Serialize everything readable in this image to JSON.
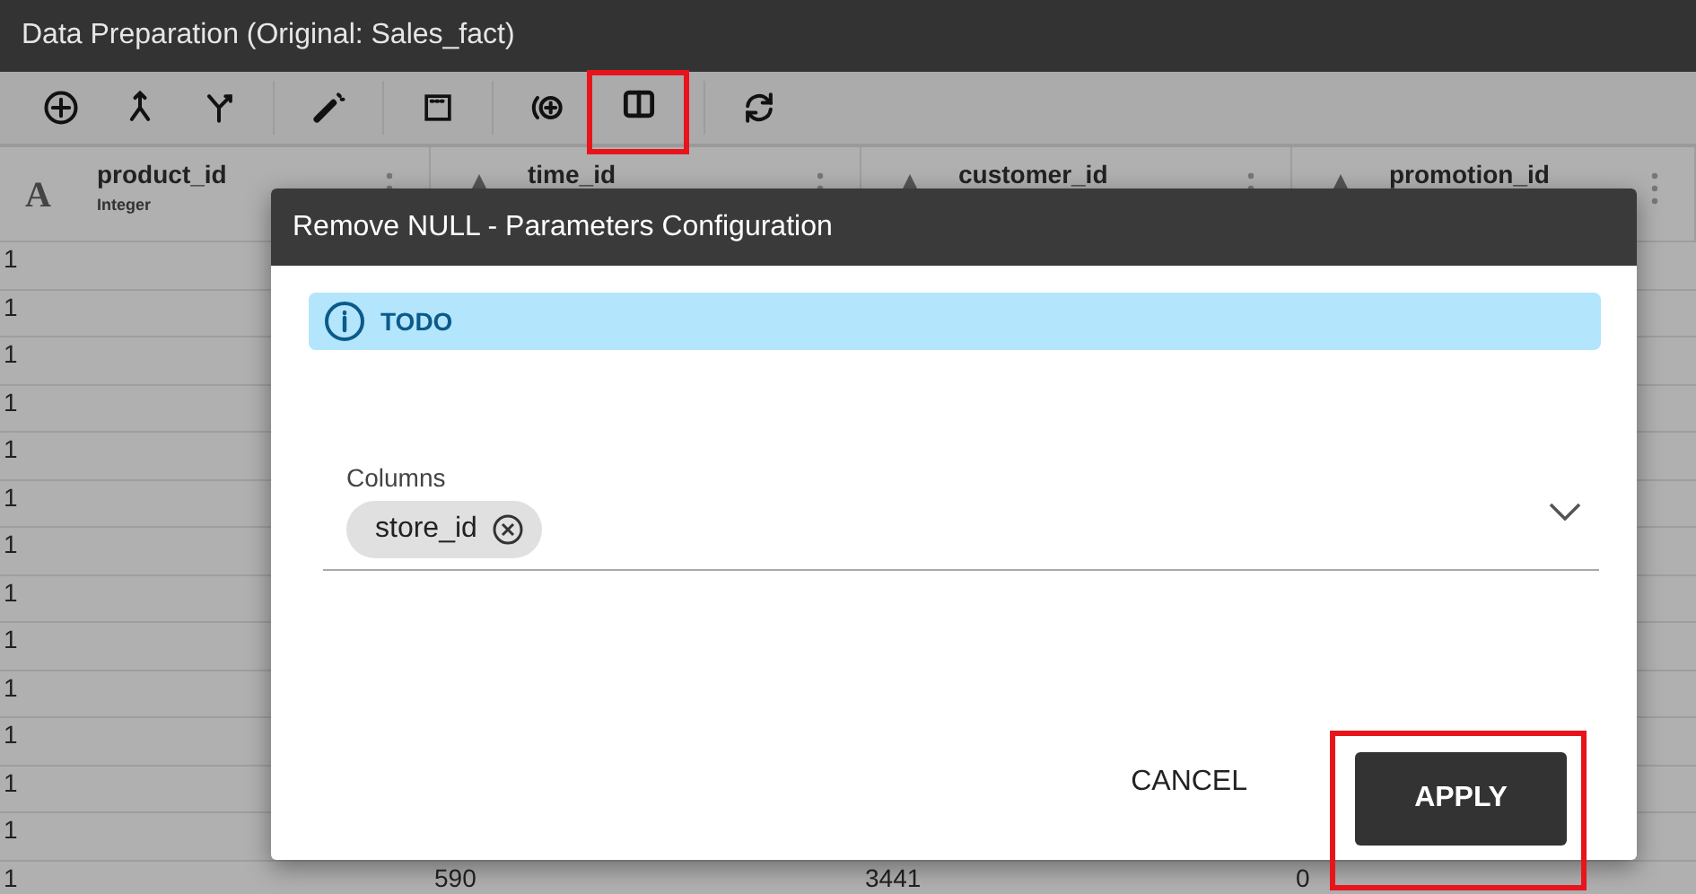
{
  "window": {
    "title": "Data Preparation (Original: Sales_fact)"
  },
  "toolbar": {
    "groups": [
      {
        "tools": [
          {
            "kind": "add",
            "highlighted": false
          },
          {
            "kind": "merge",
            "highlighted": false
          },
          {
            "kind": "split",
            "highlighted": false
          }
        ]
      },
      {
        "tools": [
          {
            "kind": "wand",
            "highlighted": false
          }
        ]
      },
      {
        "tools": [
          {
            "kind": "window",
            "highlighted": false
          }
        ]
      },
      {
        "tools": [
          {
            "kind": "add-ring",
            "highlighted": false
          },
          {
            "kind": "columns",
            "highlighted": true
          }
        ]
      },
      {
        "tools": [
          {
            "kind": "refresh",
            "highlighted": false
          }
        ]
      }
    ]
  },
  "table": {
    "columns": [
      {
        "name": "product_id",
        "type_symbol": "A",
        "type": "Integer"
      },
      {
        "name": "time_id"
      },
      {
        "name": "customer_id"
      },
      {
        "name": "promotion_id"
      }
    ],
    "rows": [
      {
        "cells": [
          "1"
        ]
      },
      {
        "cells": [
          "1"
        ]
      },
      {
        "cells": [
          "1"
        ]
      },
      {
        "cells": [
          "1"
        ]
      },
      {
        "cells": [
          "1"
        ]
      },
      {
        "cells": [
          "1"
        ]
      },
      {
        "cells": [
          "1"
        ]
      },
      {
        "cells": [
          "1"
        ]
      },
      {
        "cells": [
          "1"
        ]
      },
      {
        "cells": [
          "1"
        ]
      },
      {
        "cells": [
          "1"
        ]
      },
      {
        "cells": [
          "1"
        ]
      },
      {
        "cells": [
          "1"
        ]
      },
      {
        "cells": [
          "1",
          "590",
          "3441",
          "0"
        ]
      }
    ]
  },
  "dialog": {
    "title": "Remove NULL - Parameters Configuration",
    "info": "TODO",
    "field": {
      "label": "Columns",
      "chips": [
        "store_id"
      ]
    },
    "buttons": [
      {
        "label": "CANCEL",
        "kind": "text",
        "highlighted": false
      },
      {
        "label": "APPLY",
        "kind": "primary",
        "highlighted": true
      }
    ]
  }
}
